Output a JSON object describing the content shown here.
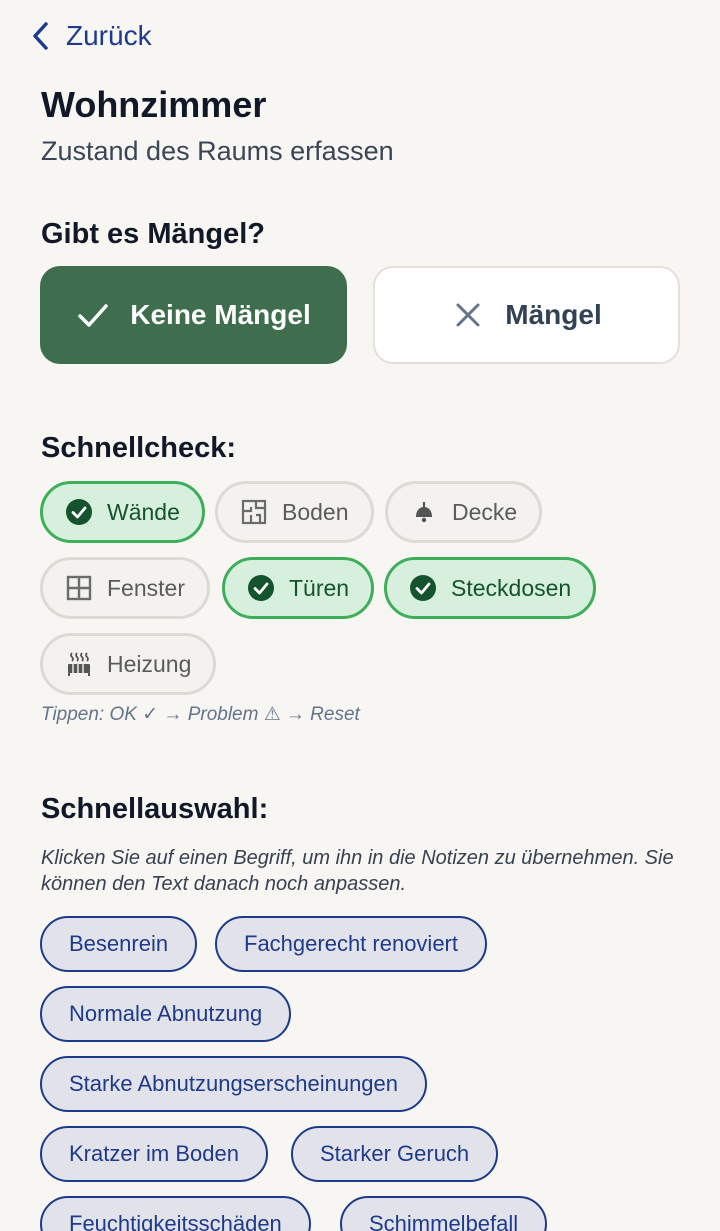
{
  "header": {
    "back_label": "Zurück"
  },
  "room": {
    "title": "Wohnzimmer",
    "subtitle": "Zustand des Raums erfassen"
  },
  "defects": {
    "question": "Gibt es Mängel?",
    "no_defects_label": "Keine Mängel",
    "defects_label": "Mängel",
    "selected": "Keine Mängel"
  },
  "quickcheck": {
    "heading": "Schnellcheck:",
    "items": [
      {
        "label": "Wände",
        "state": "ok",
        "icon": "check-circle-icon"
      },
      {
        "label": "Boden",
        "state": "none",
        "icon": "floorplan-icon"
      },
      {
        "label": "Decke",
        "state": "none",
        "icon": "ceiling-lamp-icon"
      },
      {
        "label": "Fenster",
        "state": "none",
        "icon": "window-icon"
      },
      {
        "label": "Türen",
        "state": "ok",
        "icon": "check-circle-icon"
      },
      {
        "label": "Steckdosen",
        "state": "ok",
        "icon": "check-circle-icon"
      },
      {
        "label": "Heizung",
        "state": "none",
        "icon": "heater-icon"
      }
    ],
    "hint": "Tippen: OK ✓ → Problem ⚠ → Reset"
  },
  "quickselect": {
    "heading": "Schnellauswahl:",
    "description": "Klicken Sie auf einen Begriff, um ihn in die Notizen zu übernehmen. Sie können den Text danach noch anpassen.",
    "tags": [
      "Besenrein",
      "Fachgerecht renoviert",
      "Normale Abnutzung",
      "Starke Abnutzungserscheinungen",
      "Kratzer im Boden",
      "Starker Geruch",
      "Feuchtigkeitsschäden",
      "Schimmelbefall"
    ]
  },
  "colors": {
    "accent_green": "#3e6e4e",
    "chip_ok_bg": "#d6f0dd",
    "chip_ok_border": "#3fae5a",
    "tag_blue": "#1e3a8a",
    "background": "#f8f6f3"
  }
}
